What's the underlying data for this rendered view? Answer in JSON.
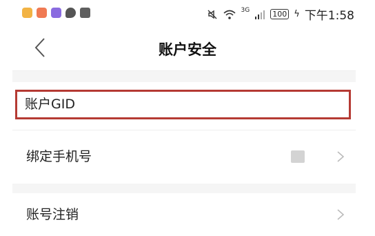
{
  "statusbar": {
    "time": "下午1:58",
    "network": "3G",
    "battery": "100",
    "app_icons": [
      "notification-icon-yellow",
      "notification-icon-orange",
      "notification-icon-purple",
      "chat-icon",
      "message-icon"
    ]
  },
  "header": {
    "title": "账户安全"
  },
  "rows": {
    "gid_label": "账户GID",
    "phone_label": "绑定手机号",
    "cancel_label": "账号注销"
  },
  "colors": {
    "highlight_border": "#b53a33",
    "background": "#ffffff",
    "band": "#f5f5f5"
  }
}
